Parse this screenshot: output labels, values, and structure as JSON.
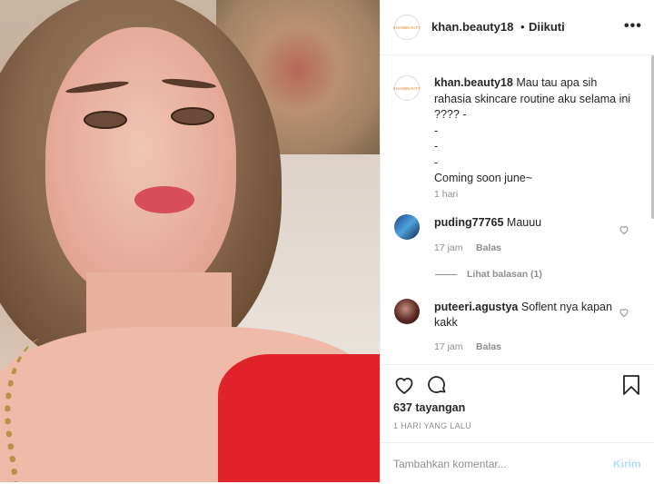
{
  "post": {
    "username": "khan.beauty18",
    "separator": "•",
    "follow_status": "Diikuti",
    "more_icon": "more-options-icon",
    "avatar_text": "KHANBEAUTY",
    "caption_user": "khan.beauty18",
    "caption_lines": [
      "Mau tau apa sih",
      "rahasia skincare routine aku selama ini",
      "???? -",
      "-",
      "-",
      "-",
      "Coming soon june~"
    ],
    "caption_time": "1 hari"
  },
  "comments": [
    {
      "user": "puding77765",
      "text": "Mauuu",
      "time": "17 jam",
      "reply": "Balas"
    },
    {
      "user": "puteeri.agustya",
      "text": "Soflent nya kapan kakk",
      "time": "17 jam",
      "reply": "Balas"
    }
  ],
  "view_replies": "Lihat balasan (1)",
  "stats": {
    "views": "637 tayangan",
    "date": "1 HARI YANG LALU"
  },
  "add_comment": {
    "placeholder": "Tambahkan komentar...",
    "send": "Kirim"
  }
}
